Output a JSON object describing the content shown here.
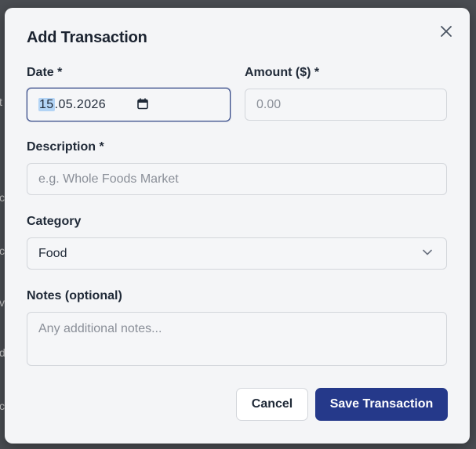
{
  "modal": {
    "title": "Add Transaction",
    "close_icon": "close-icon"
  },
  "background": {
    "letters": [
      "t",
      "c",
      "c",
      "v",
      "d",
      "c"
    ]
  },
  "fields": {
    "date": {
      "label": "Date *",
      "day": "15",
      "rest": ".05.2026",
      "icon": "calendar-icon"
    },
    "amount": {
      "label": "Amount ($) *",
      "placeholder": "0.00"
    },
    "description": {
      "label": "Description *",
      "placeholder": "e.g. Whole Foods Market"
    },
    "category": {
      "label": "Category",
      "value": "Food",
      "icon": "chevron-down-icon"
    },
    "notes": {
      "label": "Notes (optional)",
      "placeholder": "Any additional notes..."
    }
  },
  "buttons": {
    "cancel": "Cancel",
    "save": "Save Transaction"
  },
  "colors": {
    "primary": "#25398a",
    "focus_border": "#2f4585",
    "date_selection": "#b3d4f5",
    "modal_bg": "#f4f5f7",
    "placeholder": "#8a8f98"
  }
}
